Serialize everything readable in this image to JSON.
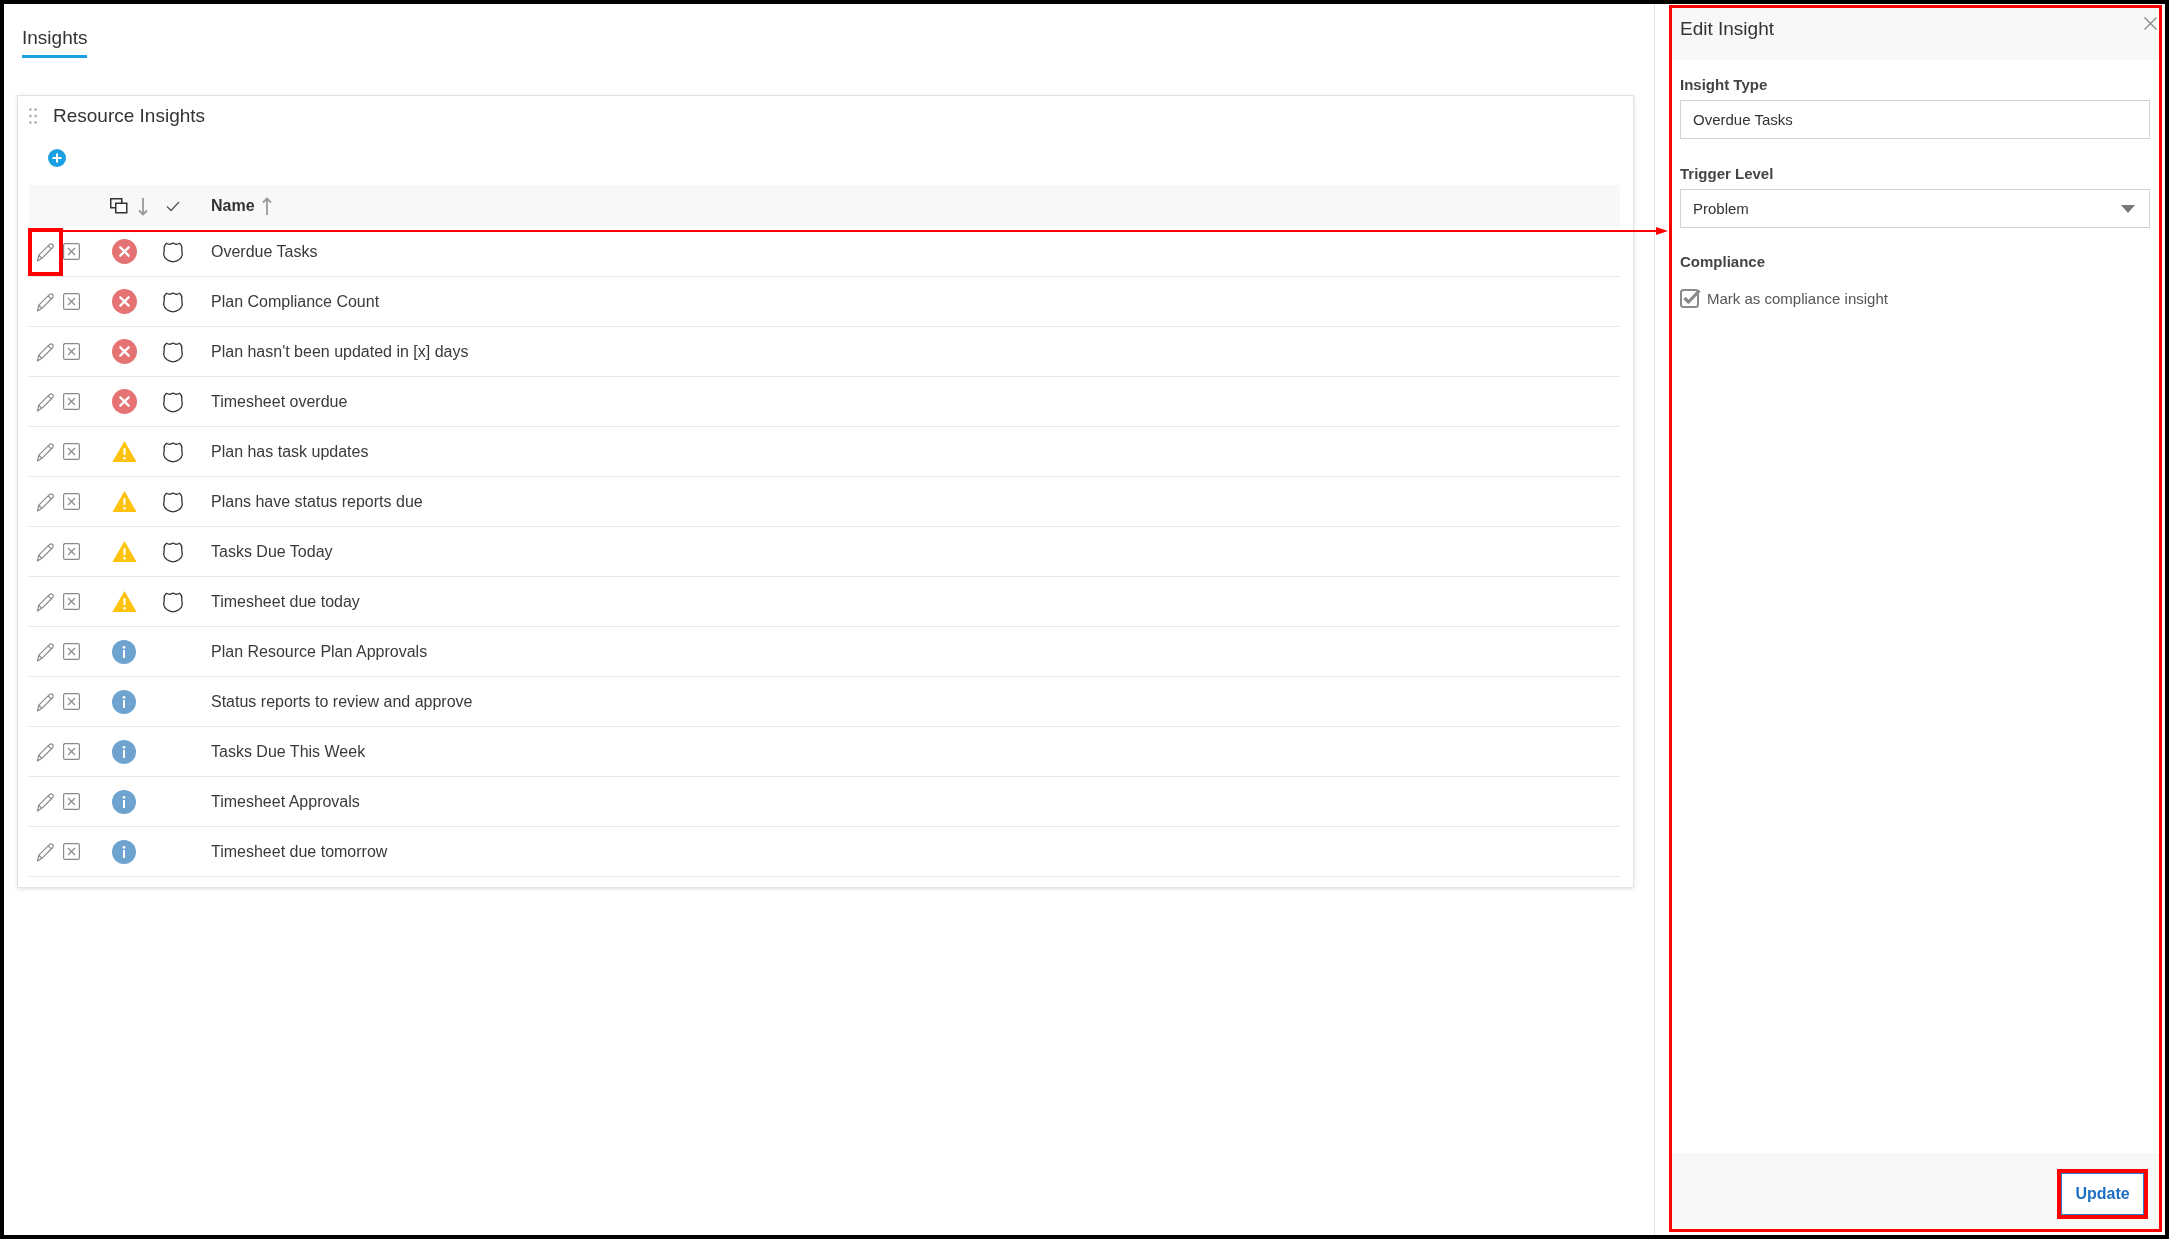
{
  "tabs": [
    {
      "label": "Insights",
      "selected": true
    }
  ],
  "card": {
    "title": "Resource Insights"
  },
  "table": {
    "columns": [
      {
        "kind": "severity",
        "sorted": true,
        "descending": true
      },
      {
        "kind": "compliance",
        "sorted": false
      },
      {
        "kind": "name",
        "label": "Name",
        "sorted": true,
        "descending": false
      }
    ],
    "rows": [
      {
        "name": "Overdue Tasks",
        "kind": "problem",
        "compliance": true,
        "highlighted": true
      },
      {
        "name": "Plan Compliance Count",
        "kind": "problem",
        "compliance": true,
        "highlighted": false
      },
      {
        "name": "Plan hasn't been updated in [x] days",
        "kind": "problem",
        "compliance": true,
        "highlighted": false
      },
      {
        "name": "Timesheet overdue",
        "kind": "problem",
        "compliance": true,
        "highlighted": false
      },
      {
        "name": "Plan has task updates",
        "kind": "warning",
        "compliance": true,
        "highlighted": false
      },
      {
        "name": "Plans have status reports due",
        "kind": "warning",
        "compliance": true,
        "highlighted": false
      },
      {
        "name": "Tasks Due Today",
        "kind": "warning",
        "compliance": true,
        "highlighted": false
      },
      {
        "name": "Timesheet due today",
        "kind": "warning",
        "compliance": true,
        "highlighted": false
      },
      {
        "name": "Plan Resource Plan Approvals",
        "kind": "info",
        "compliance": false,
        "highlighted": false
      },
      {
        "name": "Status reports to review and approve",
        "kind": "info",
        "compliance": false,
        "highlighted": false
      },
      {
        "name": "Tasks Due This Week",
        "kind": "info",
        "compliance": false,
        "highlighted": false
      },
      {
        "name": "Timesheet Approvals",
        "kind": "info",
        "compliance": false,
        "highlighted": false
      },
      {
        "name": "Timesheet due tomorrow",
        "kind": "info",
        "compliance": false,
        "highlighted": false
      }
    ]
  },
  "edit_panel": {
    "title": "Edit Insight",
    "highlighted": true,
    "fields": [
      {
        "kind": "text",
        "label": "Insight Type",
        "value": "Overdue Tasks"
      },
      {
        "kind": "select",
        "label": "Trigger Level",
        "value": "Problem"
      }
    ],
    "compliance": {
      "label": "Compliance",
      "option": "Mark as compliance insight",
      "checked": true
    },
    "update_button": {
      "label": "Update",
      "highlighted": true
    }
  }
}
